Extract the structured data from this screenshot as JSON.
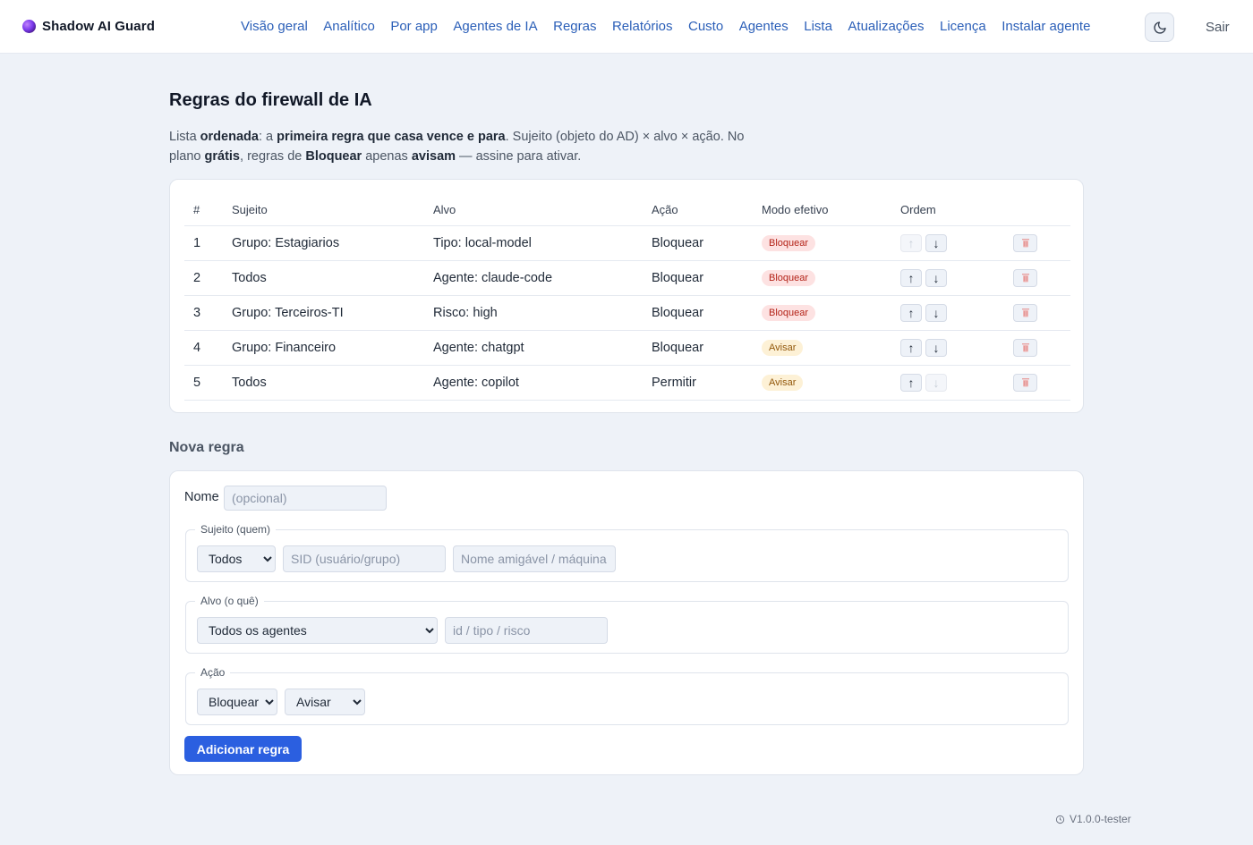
{
  "brand": {
    "name": "Shadow AI Guard"
  },
  "nav": [
    "Visão geral",
    "Analítico",
    "Por app",
    "Agentes de IA",
    "Regras",
    "Relatórios",
    "Custo",
    "Agentes",
    "Lista",
    "Atualizações",
    "Licença",
    "Instalar agente"
  ],
  "header": {
    "logout": "Sair",
    "theme_icon": "moon-icon"
  },
  "page": {
    "title": "Regras do firewall de IA",
    "intro_parts": {
      "a": "Lista ",
      "b": "ordenada",
      "c": ": a ",
      "d": "primeira regra que casa vence e para",
      "e": ". Sujeito (objeto do AD) × alvo × ação. No plano ",
      "f": "grátis",
      "g": ", regras de ",
      "h": "Bloquear",
      "i": " apenas ",
      "j": "avisam",
      "k": " — assine para ativar."
    }
  },
  "table": {
    "headers": [
      "#",
      "Sujeito",
      "Alvo",
      "Ação",
      "Modo efetivo",
      "Ordem",
      ""
    ],
    "rows": [
      {
        "n": "1",
        "subject": "Grupo: Estagiarios",
        "target": "Tipo: local-model",
        "action": "Bloquear",
        "mode": "Bloquear",
        "mode_kind": "block",
        "up": false,
        "down": true
      },
      {
        "n": "2",
        "subject": "Todos",
        "target": "Agente: claude-code",
        "action": "Bloquear",
        "mode": "Bloquear",
        "mode_kind": "block",
        "up": true,
        "down": true
      },
      {
        "n": "3",
        "subject": "Grupo: Terceiros-TI",
        "target": "Risco: high",
        "action": "Bloquear",
        "mode": "Bloquear",
        "mode_kind": "block",
        "up": true,
        "down": true
      },
      {
        "n": "4",
        "subject": "Grupo: Financeiro",
        "target": "Agente: chatgpt",
        "action": "Bloquear",
        "mode": "Avisar",
        "mode_kind": "warn",
        "up": true,
        "down": true
      },
      {
        "n": "5",
        "subject": "Todos",
        "target": "Agente: copilot",
        "action": "Permitir",
        "mode": "Avisar",
        "mode_kind": "warn",
        "up": true,
        "down": false
      }
    ],
    "up_glyph": "↑",
    "down_glyph": "↓",
    "delete_icon": "trash-icon"
  },
  "new_rule": {
    "title": "Nova regra",
    "name_label": "Nome",
    "name_placeholder": "(opcional)",
    "subject_legend": "Sujeito (quem)",
    "subject_select": "Todos",
    "sid_placeholder": "SID (usuário/grupo)",
    "friendly_placeholder": "Nome amigável / máquina",
    "target_legend": "Alvo (o quê)",
    "target_select": "Todos os agentes",
    "target_placeholder": "id / tipo / risco",
    "action_legend": "Ação",
    "action_select": "Bloquear",
    "mode_select": "Avisar",
    "submit": "Adicionar regra"
  },
  "footer": {
    "version": "V1.0.0-tester"
  }
}
